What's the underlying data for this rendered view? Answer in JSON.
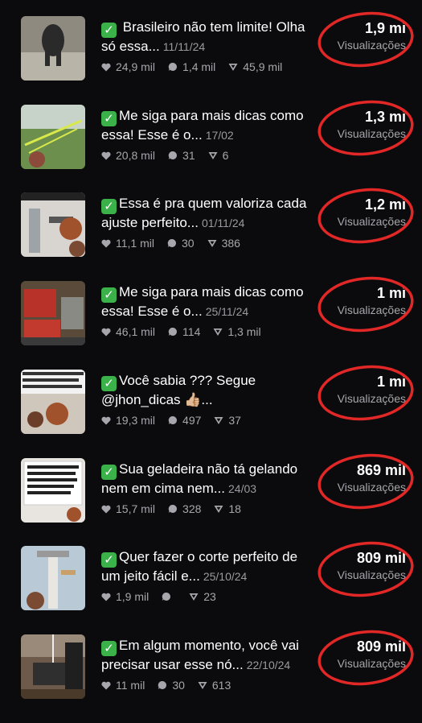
{
  "colors": {
    "check": "#3bb14a",
    "highlight": "#e22727",
    "background": "#0b0b0d"
  },
  "check_glyph": "✓",
  "views_label": "Visualizações",
  "videos": [
    {
      "title": "Brasileiro não tem limite! Olha só essa...",
      "date": "11/11/24",
      "likes": "24,9 mil",
      "comments": "1,4 mil",
      "shares": "45,9 mil",
      "views": "1,9 mi"
    },
    {
      "title": "Me siga para mais dicas como essa! Esse é o...",
      "date": "17/02",
      "likes": "20,8 mil",
      "comments": "31",
      "shares": "6",
      "views": "1,3 mi"
    },
    {
      "title": "Essa é pra quem valoriza cada ajuste perfeito...",
      "date": "01/11/24",
      "likes": "11,1 mil",
      "comments": "30",
      "shares": "386",
      "views": "1,2 mi"
    },
    {
      "title": "Me siga para mais dicas como essa! Esse é o...",
      "date": "25/11/24",
      "likes": "46,1 mil",
      "comments": "114",
      "shares": "1,3 mil",
      "views": "1 mi"
    },
    {
      "title": "Você sabia ??? Segue @jhon_dicas 👍🏼...",
      "date": "",
      "likes": "19,3 mil",
      "comments": "497",
      "shares": "37",
      "views": "1 mi"
    },
    {
      "title": "Sua geladeira não tá gelando nem em cima nem...",
      "date": "24/03",
      "likes": "15,7 mil",
      "comments": "328",
      "shares": "18",
      "views": "869 mil"
    },
    {
      "title": "Quer fazer o corte perfeito de um jeito fácil e...",
      "date": "25/10/24",
      "likes": "1,9 mil",
      "comments": "",
      "shares": "23",
      "views": "809 mil"
    },
    {
      "title": "Em algum momento, você vai precisar usar esse nó...",
      "date": "22/10/24",
      "likes": "11 mil",
      "comments": "30",
      "shares": "613",
      "views": "809 mil"
    }
  ]
}
